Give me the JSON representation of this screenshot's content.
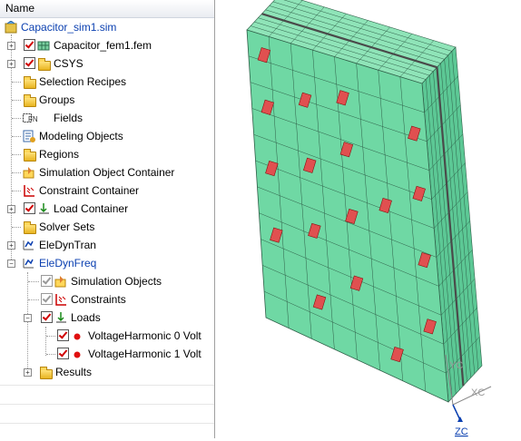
{
  "tree": {
    "header": "Name",
    "items": [
      {
        "label": "Capacitor_sim1.sim",
        "icon": "simulation-file-icon"
      },
      {
        "label": "Capacitor_fem1.fem",
        "icon": "fem-mesh-icon"
      },
      {
        "label": "CSYS",
        "icon": "folder-icon"
      },
      {
        "label": "Selection Recipes",
        "icon": "folder-icon"
      },
      {
        "label": "Groups",
        "icon": "folder-icon"
      },
      {
        "label": "Fields",
        "icon": "fields-icon"
      },
      {
        "label": "Modeling Objects",
        "icon": "modeling-objects-icon"
      },
      {
        "label": "Regions",
        "icon": "folder-icon"
      },
      {
        "label": "Simulation Object Container",
        "icon": "simulation-object-icon"
      },
      {
        "label": "Constraint Container",
        "icon": "constraint-icon"
      },
      {
        "label": "Load Container",
        "icon": "load-icon"
      },
      {
        "label": "Solver Sets",
        "icon": "folder-icon"
      },
      {
        "label": "EleDynTran",
        "icon": "solution-icon"
      },
      {
        "label": "EleDynFreq",
        "icon": "solution-icon"
      },
      {
        "label": "Simulation Objects",
        "icon": "simulation-object-icon"
      },
      {
        "label": "Constraints",
        "icon": "constraint-icon"
      },
      {
        "label": "Loads",
        "icon": "load-icon"
      },
      {
        "label": "VoltageHarmonic 0 Volt",
        "icon": "red-dot-icon"
      },
      {
        "label": "VoltageHarmonic 1 Volt",
        "icon": "red-dot-icon"
      },
      {
        "label": "Results",
        "icon": "folder-icon"
      }
    ]
  },
  "viewport": {
    "axis_labels": {
      "y": "YC",
      "x": "XC",
      "z": "ZC"
    },
    "colors": {
      "mesh_fill": "#6fd8a4",
      "mesh_line": "#2f5f48",
      "marker": "#e05050",
      "accent_blue": "#0a3fb0"
    }
  }
}
